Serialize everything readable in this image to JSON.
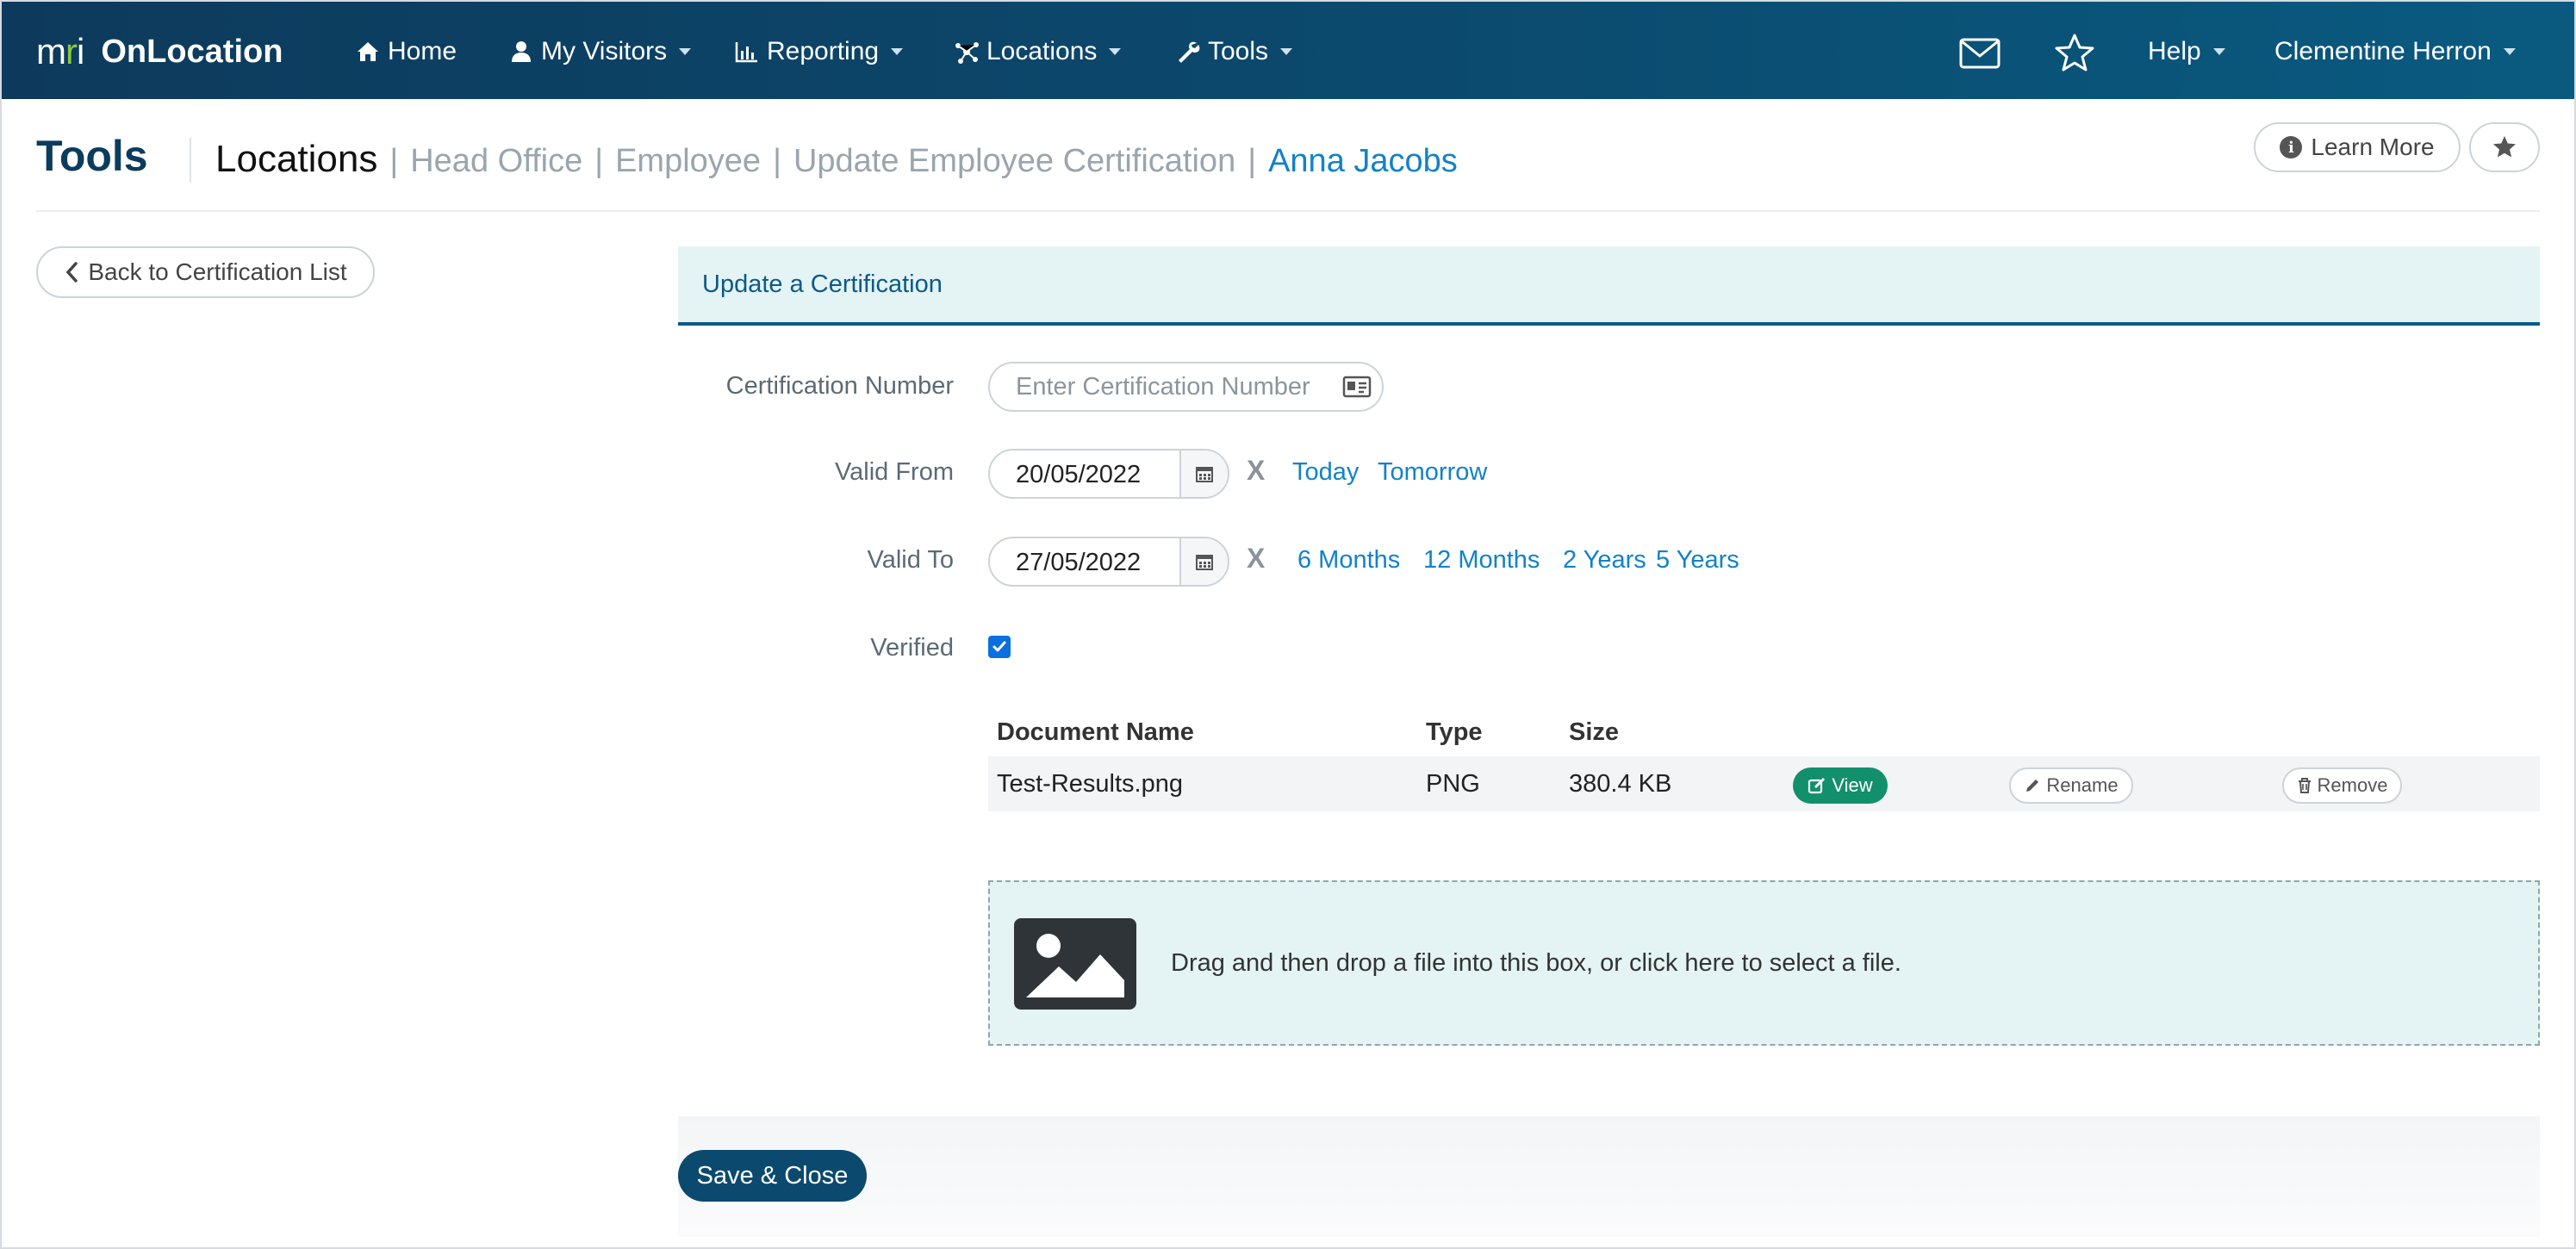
{
  "brand": {
    "logo_text_m": "m",
    "logo_text_r": "r",
    "logo_text_i": "i",
    "product": "OnLocation"
  },
  "nav": {
    "home": "Home",
    "visitors": "My Visitors",
    "reporting": "Reporting",
    "locations": "Locations",
    "tools": "Tools",
    "help": "Help",
    "user": "Clementine Herron"
  },
  "header": {
    "title": "Tools",
    "breadcrumbs": {
      "current": "Locations",
      "sep": "|",
      "head_office": "Head Office",
      "employee": "Employee",
      "update_cert": "Update Employee Certification",
      "person": "Anna Jacobs"
    },
    "learn_more": "Learn More"
  },
  "back_button": "Back to Certification List",
  "form": {
    "panel_title": "Update a Certification",
    "cert_number_label": "Certification Number",
    "cert_number_placeholder": "Enter Certification Number",
    "cert_number_value": "",
    "valid_from_label": "Valid From",
    "valid_from_value": "20/05/2022",
    "valid_to_label": "Valid To",
    "valid_to_value": "27/05/2022",
    "clear": "X",
    "from_quick": [
      "Today",
      "Tomorrow"
    ],
    "to_quick": [
      "6 Months",
      "12 Months",
      "2 Years",
      "5 Years"
    ],
    "verified_label": "Verified",
    "verified": true
  },
  "documents": {
    "headers": {
      "name": "Document Name",
      "type": "Type",
      "size": "Size"
    },
    "rows": [
      {
        "name": "Test-Results.png",
        "type": "PNG",
        "size": "380.4 KB"
      }
    ],
    "view": "View",
    "rename": "Rename",
    "remove": "Remove"
  },
  "dropzone_text": "Drag and then drop a file into this box, or click here to select a file.",
  "save_button": "Save & Close",
  "colors": {
    "nav_bg": "#0d3a5c",
    "accent": "#1282c8",
    "primary": "#0b4a6e",
    "success": "#12906b",
    "panel": "#e4f3f3"
  }
}
